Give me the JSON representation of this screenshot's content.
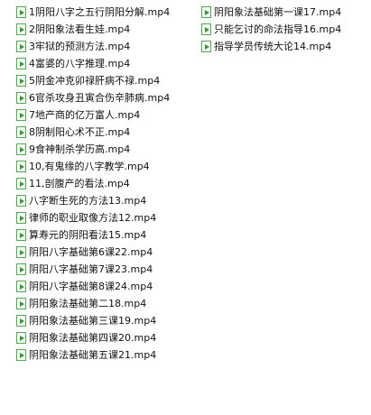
{
  "colors": {
    "icon_border": "#5aa35a",
    "icon_fill": "#3c8f3c",
    "text": "#111111",
    "background": "#ffffff"
  },
  "icon": "video-file-icon",
  "files_left": [
    "1阴阳八字之五行阴阳分解.mp4",
    "2阴阳象法看生娃.mp4",
    "3牢狱的预测方法.mp4",
    "4富婆的八字推理.mp4",
    "5阴金冲克卯禄肝病不禄.mp4",
    "6官杀攻身丑寅合伤辛肺病.mp4",
    "7地产商的亿万富人.mp4",
    "8阴制阳心术不正.mp4",
    "9食神制杀学历高.mp4",
    "10,有鬼缘的八字教学.mp4",
    "11,剖腹产的看法.mp4",
    "八字断生死的方法13.mp4",
    "律师的职业取像方法12.mp4",
    "算寿元的阴阳看法15.mp4",
    "阴阳八字基础第6课22.mp4",
    "阴阳八字基础第7课23.mp4",
    "阴阳八字基础第8课24.mp4",
    "阴阳象法基础第二18.mp4",
    "阴阳象法基础第三课19.mp4",
    "阴阳象法基础第四课20.mp4",
    "阴阳象法基础第五课21.mp4"
  ],
  "files_right": [
    "阴阳象法基础第一课17.mp4",
    "只能乞讨的命法指导16.mp4",
    "指导学员传统大论14.mp4"
  ]
}
